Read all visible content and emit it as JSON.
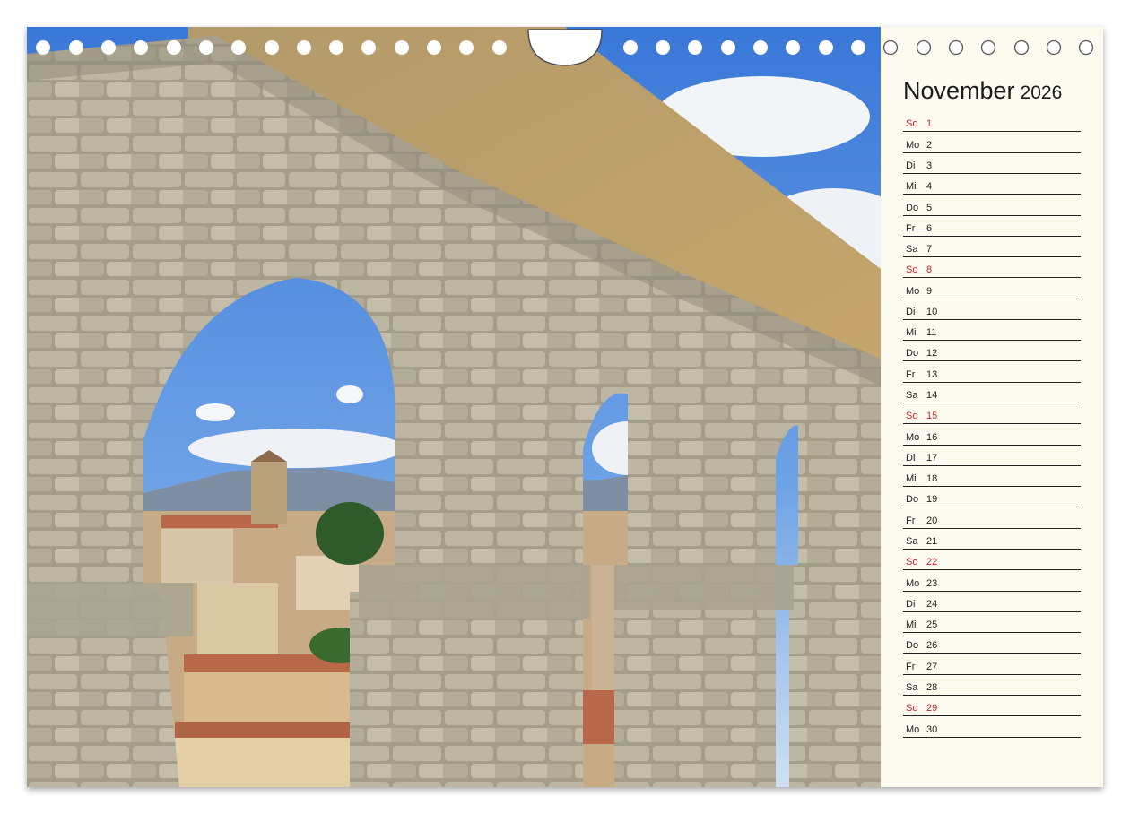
{
  "calendar": {
    "month": "November",
    "year": "2026",
    "days": [
      {
        "wd": "So",
        "d": "1",
        "sunday": true
      },
      {
        "wd": "Mo",
        "d": "2"
      },
      {
        "wd": "Di",
        "d": "3"
      },
      {
        "wd": "Mi",
        "d": "4"
      },
      {
        "wd": "Do",
        "d": "5"
      },
      {
        "wd": "Fr",
        "d": "6"
      },
      {
        "wd": "Sa",
        "d": "7"
      },
      {
        "wd": "So",
        "d": "8",
        "sunday": true
      },
      {
        "wd": "Mo",
        "d": "9"
      },
      {
        "wd": "Di",
        "d": "10"
      },
      {
        "wd": "Mi",
        "d": "11"
      },
      {
        "wd": "Do",
        "d": "12"
      },
      {
        "wd": "Fr",
        "d": "13"
      },
      {
        "wd": "Sa",
        "d": "14"
      },
      {
        "wd": "So",
        "d": "15",
        "sunday": true
      },
      {
        "wd": "Mo",
        "d": "16"
      },
      {
        "wd": "Di",
        "d": "17"
      },
      {
        "wd": "Mi",
        "d": "18"
      },
      {
        "wd": "Do",
        "d": "19"
      },
      {
        "wd": "Fr",
        "d": "20"
      },
      {
        "wd": "Sa",
        "d": "21"
      },
      {
        "wd": "So",
        "d": "22",
        "sunday": true
      },
      {
        "wd": "Mo",
        "d": "23"
      },
      {
        "wd": "Di",
        "d": "24"
      },
      {
        "wd": "Mi",
        "d": "25"
      },
      {
        "wd": "Do",
        "d": "26"
      },
      {
        "wd": "Fr",
        "d": "27"
      },
      {
        "wd": "Sa",
        "d": "28"
      },
      {
        "wd": "So",
        "d": "29",
        "sunday": true
      },
      {
        "wd": "Mo",
        "d": "30"
      }
    ]
  },
  "colors": {
    "sunday": "#c0282a",
    "text": "#222222",
    "panel_background": "#fdfbf0"
  }
}
